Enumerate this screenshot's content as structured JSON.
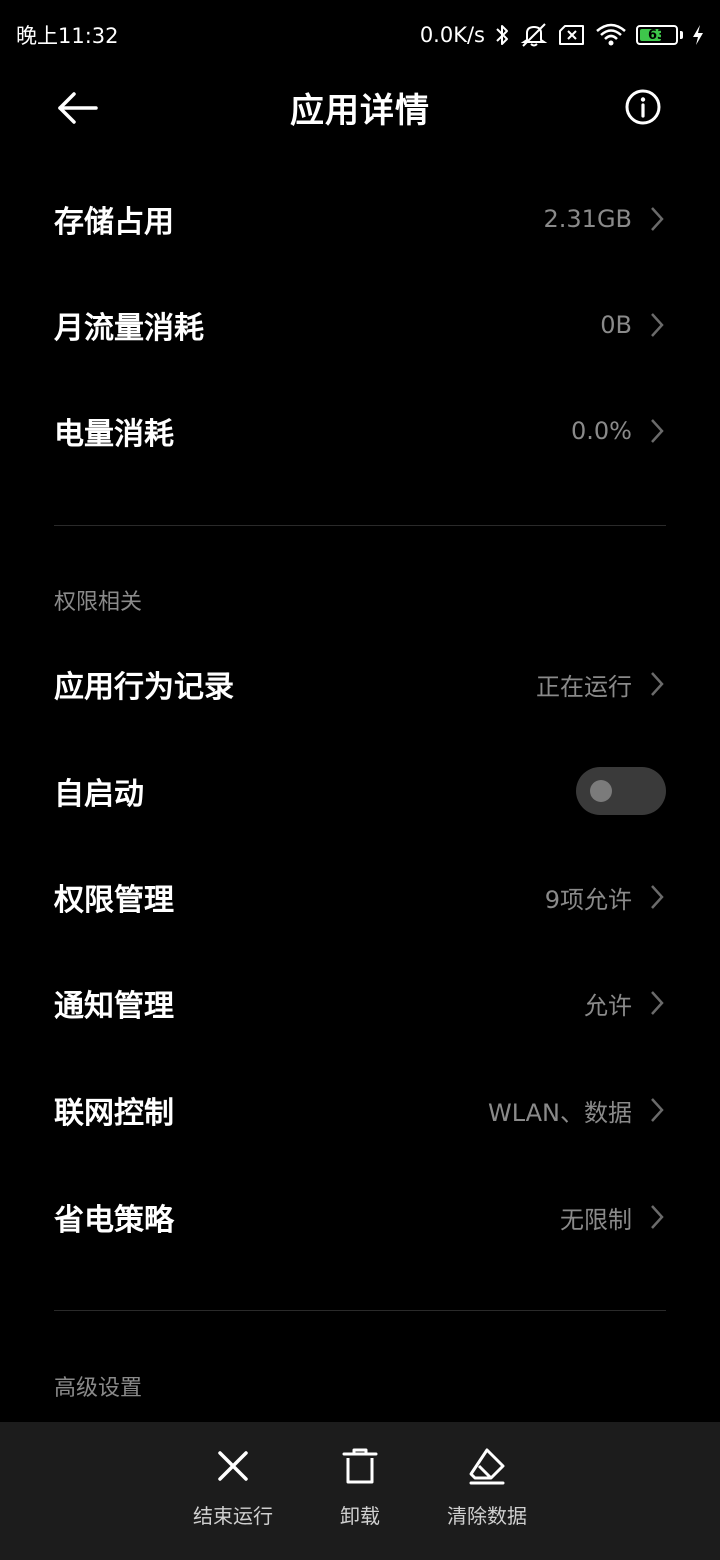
{
  "status_bar": {
    "time": "晚上11:32",
    "net_speed": "0.0K/s",
    "battery_level": 63,
    "battery_text": "63",
    "battery_color": "#3ec64b"
  },
  "header": {
    "title": "应用详情",
    "back_icon": "arrow-left-icon",
    "info_icon": "info-circle-icon"
  },
  "usage": [
    {
      "label": "存储占用",
      "value": "2.31GB"
    },
    {
      "label": "月流量消耗",
      "value": "0B"
    },
    {
      "label": "电量消耗",
      "value": "0.0%"
    }
  ],
  "permissions": {
    "section_title": "权限相关",
    "behavior_record": {
      "label": "应用行为记录",
      "value": "正在运行"
    },
    "autostart": {
      "label": "自启动",
      "enabled": false
    },
    "permission_mgmt": {
      "label": "权限管理",
      "value": "9项允许"
    },
    "notification_mgmt": {
      "label": "通知管理",
      "value": "允许"
    },
    "network_control": {
      "label": "联网控制",
      "value": "WLAN、数据"
    },
    "power_strategy": {
      "label": "省电策略",
      "value": "无限制"
    }
  },
  "advanced": {
    "section_title": "高级设置"
  },
  "bottom_actions": [
    {
      "label": "结束运行",
      "icon": "close-icon"
    },
    {
      "label": "卸载",
      "icon": "trash-icon"
    },
    {
      "label": "清除数据",
      "icon": "eraser-icon"
    }
  ],
  "colors": {
    "background": "#000000",
    "secondary_text": "#8a8a8a",
    "bottom_bar": "#1c1c1c"
  }
}
